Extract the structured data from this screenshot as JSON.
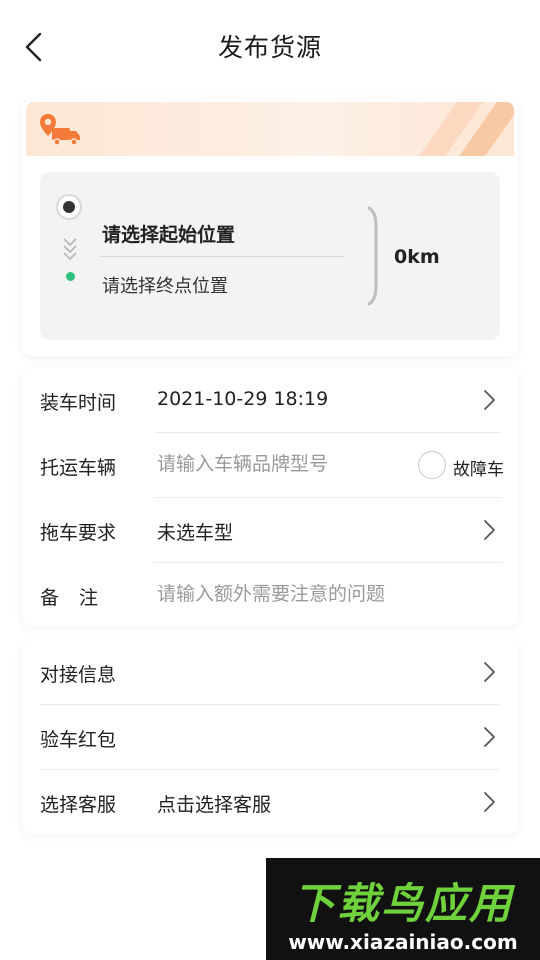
{
  "header": {
    "title": "发布货源",
    "back_icon": "chevron-left-icon"
  },
  "route": {
    "banner_icon": "truck-location-icon",
    "start_placeholder": "请选择起始位置",
    "end_placeholder": "请选择终点位置",
    "distance": "0km",
    "colors": {
      "banner": "#fde6d4",
      "end_dot": "#2ec27e"
    }
  },
  "form": {
    "load_time": {
      "label": "装车时间",
      "value": "2021-10-29 18:19"
    },
    "vehicle": {
      "label": "托运车辆",
      "placeholder": "请输入车辆品牌型号",
      "fault_label": "故障车"
    },
    "tow_requirement": {
      "label": "拖车要求",
      "value": "未选车型"
    },
    "remark": {
      "label": "备注",
      "placeholder": "请输入额外需要注意的问题"
    }
  },
  "service": {
    "contact": {
      "label": "对接信息"
    },
    "red_packet": {
      "label": "验车红包"
    },
    "customer_service": {
      "label": "选择客服",
      "value": "点击选择客服"
    }
  },
  "watermark": {
    "title": "下载鸟应用",
    "url": "www.xiazainiao.com"
  }
}
